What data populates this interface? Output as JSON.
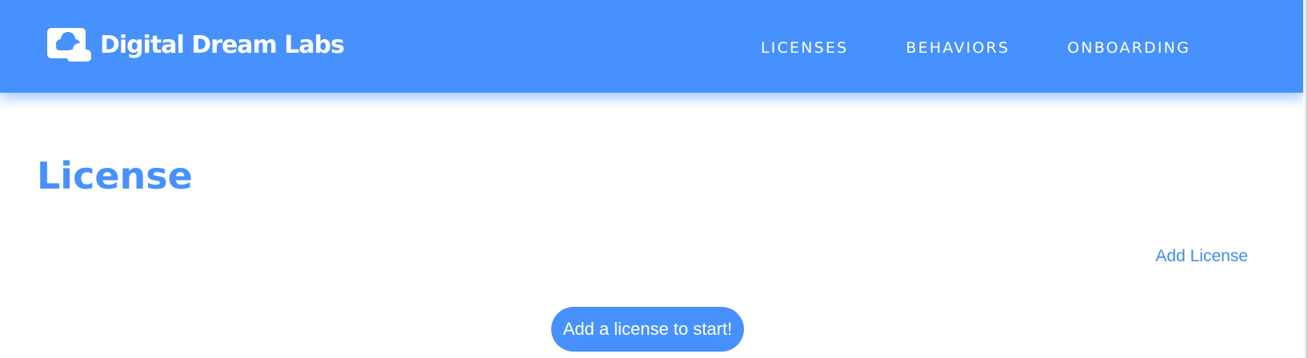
{
  "header": {
    "brand_name": "Digital Dream Labs",
    "brand_icon": "cloud-logo-icon",
    "nav": [
      {
        "label": "LICENSES"
      },
      {
        "label": "BEHAVIORS"
      },
      {
        "label": "ONBOARDING"
      }
    ]
  },
  "main": {
    "title": "License",
    "add_link_label": "Add License",
    "empty_state_button": "Add a license to start!"
  },
  "colors": {
    "brand_blue": "#4791ff",
    "white": "#ffffff"
  }
}
